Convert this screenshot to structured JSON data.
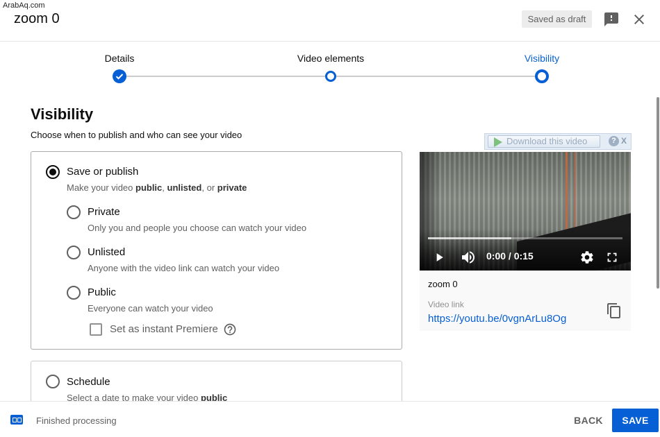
{
  "watermark": "ArabAq.com",
  "header": {
    "title": "zoom 0",
    "saved_status": "Saved as draft"
  },
  "stepper": {
    "steps": [
      {
        "label": "Details",
        "state": "done"
      },
      {
        "label": "Video elements",
        "state": "open"
      },
      {
        "label": "Visibility",
        "state": "active"
      }
    ]
  },
  "visibility": {
    "title": "Visibility",
    "subtitle": "Choose when to publish and who can see your video",
    "save_publish": {
      "label": "Save or publish",
      "desc_prefix": "Make your video ",
      "desc_public": "public",
      "desc_sep1": ", ",
      "desc_unlisted": "unlisted",
      "desc_sep2": ", or ",
      "desc_private": "private",
      "checked": true
    },
    "options": [
      {
        "label": "Private",
        "desc": "Only you and people you choose can watch your video"
      },
      {
        "label": "Unlisted",
        "desc": "Anyone with the video link can watch your video"
      },
      {
        "label": "Public",
        "desc": "Everyone can watch your video"
      }
    ],
    "premiere_label": "Set as instant Premiere",
    "schedule": {
      "label": "Schedule",
      "desc_prefix": "Select a date to make your video ",
      "desc_bold": "public"
    }
  },
  "download_bar": {
    "label": "Download this video",
    "help": "?",
    "close": "X"
  },
  "preview": {
    "time": "0:00 / 0:15",
    "played_fraction": 0.43,
    "name": "zoom 0",
    "link_label": "Video link",
    "link": "https://youtu.be/0vgnArLu8Og"
  },
  "footer": {
    "status": "Finished processing",
    "back": "BACK",
    "save": "SAVE"
  },
  "colors": {
    "accent": "#065fd4",
    "text": "#0d0d0d",
    "secondary_text": "#606060"
  }
}
